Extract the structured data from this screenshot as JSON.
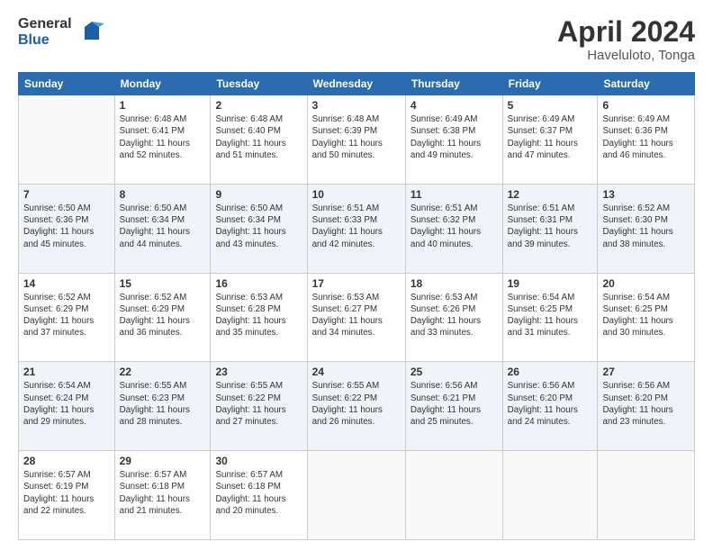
{
  "logo": {
    "general": "General",
    "blue": "Blue"
  },
  "title": "April 2024",
  "subtitle": "Haveluloto, Tonga",
  "header_days": [
    "Sunday",
    "Monday",
    "Tuesday",
    "Wednesday",
    "Thursday",
    "Friday",
    "Saturday"
  ],
  "weeks": [
    [
      {
        "day": "",
        "info": ""
      },
      {
        "day": "1",
        "info": "Sunrise: 6:48 AM\nSunset: 6:41 PM\nDaylight: 11 hours\nand 52 minutes."
      },
      {
        "day": "2",
        "info": "Sunrise: 6:48 AM\nSunset: 6:40 PM\nDaylight: 11 hours\nand 51 minutes."
      },
      {
        "day": "3",
        "info": "Sunrise: 6:48 AM\nSunset: 6:39 PM\nDaylight: 11 hours\nand 50 minutes."
      },
      {
        "day": "4",
        "info": "Sunrise: 6:49 AM\nSunset: 6:38 PM\nDaylight: 11 hours\nand 49 minutes."
      },
      {
        "day": "5",
        "info": "Sunrise: 6:49 AM\nSunset: 6:37 PM\nDaylight: 11 hours\nand 47 minutes."
      },
      {
        "day": "6",
        "info": "Sunrise: 6:49 AM\nSunset: 6:36 PM\nDaylight: 11 hours\nand 46 minutes."
      }
    ],
    [
      {
        "day": "7",
        "info": "Sunrise: 6:50 AM\nSunset: 6:36 PM\nDaylight: 11 hours\nand 45 minutes."
      },
      {
        "day": "8",
        "info": "Sunrise: 6:50 AM\nSunset: 6:34 PM\nDaylight: 11 hours\nand 44 minutes."
      },
      {
        "day": "9",
        "info": "Sunrise: 6:50 AM\nSunset: 6:34 PM\nDaylight: 11 hours\nand 43 minutes."
      },
      {
        "day": "10",
        "info": "Sunrise: 6:51 AM\nSunset: 6:33 PM\nDaylight: 11 hours\nand 42 minutes."
      },
      {
        "day": "11",
        "info": "Sunrise: 6:51 AM\nSunset: 6:32 PM\nDaylight: 11 hours\nand 40 minutes."
      },
      {
        "day": "12",
        "info": "Sunrise: 6:51 AM\nSunset: 6:31 PM\nDaylight: 11 hours\nand 39 minutes."
      },
      {
        "day": "13",
        "info": "Sunrise: 6:52 AM\nSunset: 6:30 PM\nDaylight: 11 hours\nand 38 minutes."
      }
    ],
    [
      {
        "day": "14",
        "info": "Sunrise: 6:52 AM\nSunset: 6:29 PM\nDaylight: 11 hours\nand 37 minutes."
      },
      {
        "day": "15",
        "info": "Sunrise: 6:52 AM\nSunset: 6:29 PM\nDaylight: 11 hours\nand 36 minutes."
      },
      {
        "day": "16",
        "info": "Sunrise: 6:53 AM\nSunset: 6:28 PM\nDaylight: 11 hours\nand 35 minutes."
      },
      {
        "day": "17",
        "info": "Sunrise: 6:53 AM\nSunset: 6:27 PM\nDaylight: 11 hours\nand 34 minutes."
      },
      {
        "day": "18",
        "info": "Sunrise: 6:53 AM\nSunset: 6:26 PM\nDaylight: 11 hours\nand 33 minutes."
      },
      {
        "day": "19",
        "info": "Sunrise: 6:54 AM\nSunset: 6:25 PM\nDaylight: 11 hours\nand 31 minutes."
      },
      {
        "day": "20",
        "info": "Sunrise: 6:54 AM\nSunset: 6:25 PM\nDaylight: 11 hours\nand 30 minutes."
      }
    ],
    [
      {
        "day": "21",
        "info": "Sunrise: 6:54 AM\nSunset: 6:24 PM\nDaylight: 11 hours\nand 29 minutes."
      },
      {
        "day": "22",
        "info": "Sunrise: 6:55 AM\nSunset: 6:23 PM\nDaylight: 11 hours\nand 28 minutes."
      },
      {
        "day": "23",
        "info": "Sunrise: 6:55 AM\nSunset: 6:22 PM\nDaylight: 11 hours\nand 27 minutes."
      },
      {
        "day": "24",
        "info": "Sunrise: 6:55 AM\nSunset: 6:22 PM\nDaylight: 11 hours\nand 26 minutes."
      },
      {
        "day": "25",
        "info": "Sunrise: 6:56 AM\nSunset: 6:21 PM\nDaylight: 11 hours\nand 25 minutes."
      },
      {
        "day": "26",
        "info": "Sunrise: 6:56 AM\nSunset: 6:20 PM\nDaylight: 11 hours\nand 24 minutes."
      },
      {
        "day": "27",
        "info": "Sunrise: 6:56 AM\nSunset: 6:20 PM\nDaylight: 11 hours\nand 23 minutes."
      }
    ],
    [
      {
        "day": "28",
        "info": "Sunrise: 6:57 AM\nSunset: 6:19 PM\nDaylight: 11 hours\nand 22 minutes."
      },
      {
        "day": "29",
        "info": "Sunrise: 6:57 AM\nSunset: 6:18 PM\nDaylight: 11 hours\nand 21 minutes."
      },
      {
        "day": "30",
        "info": "Sunrise: 6:57 AM\nSunset: 6:18 PM\nDaylight: 11 hours\nand 20 minutes."
      },
      {
        "day": "",
        "info": ""
      },
      {
        "day": "",
        "info": ""
      },
      {
        "day": "",
        "info": ""
      },
      {
        "day": "",
        "info": ""
      }
    ]
  ]
}
